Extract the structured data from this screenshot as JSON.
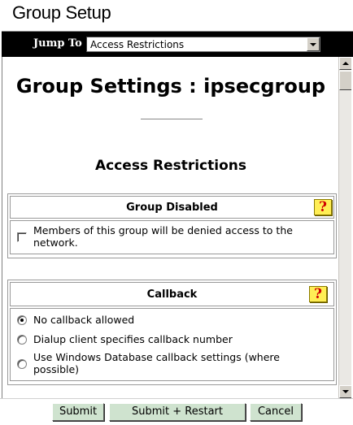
{
  "app_title": "Group Setup",
  "jump": {
    "label": "Jump To",
    "selected": "Access Restrictions"
  },
  "page": {
    "title": "Group Settings : ipsecgroup",
    "section": "Access Restrictions"
  },
  "group_disabled": {
    "title": "Group Disabled",
    "help": "?",
    "option_label": "Members of this group will be denied access to the network.",
    "checked": false
  },
  "callback": {
    "title": "Callback",
    "help": "?",
    "options": [
      {
        "label": "No callback allowed",
        "selected": true
      },
      {
        "label": "Dialup client specifies callback number",
        "selected": false
      },
      {
        "label": "Use Windows Database callback settings (where possible)",
        "selected": false
      }
    ]
  },
  "buttons": {
    "submit": "Submit",
    "submit_restart": "Submit + Restart",
    "cancel": "Cancel"
  },
  "colors": {
    "jumpbar_bg": "#000000",
    "button_bg": "#cfe3cf",
    "help_icon_bg": "#ffee55",
    "help_icon_fg": "#d00000"
  }
}
